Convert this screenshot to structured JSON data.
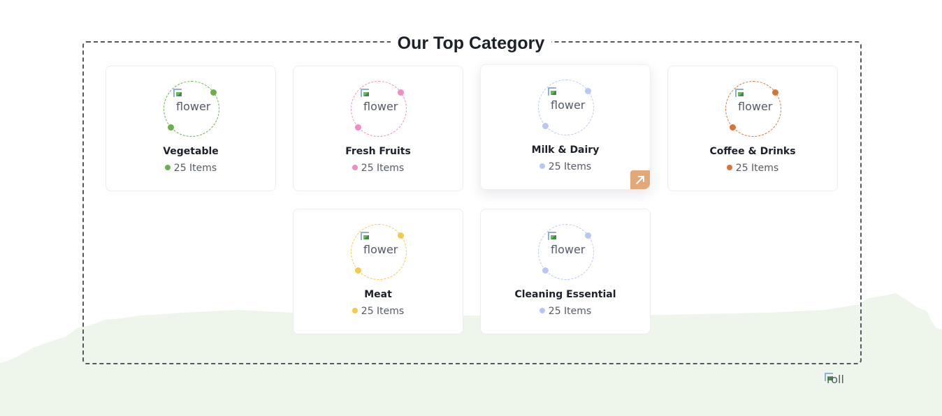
{
  "section": {
    "title": "Our Top Category"
  },
  "categories": [
    {
      "name": "Vegetable",
      "count": "25 Items",
      "image_alt": "flower",
      "color": "#6ab04c"
    },
    {
      "name": "Fresh Fruits",
      "count": "25 Items",
      "image_alt": "flower",
      "color": "#f08bc4"
    },
    {
      "name": "Milk & Dairy",
      "count": "25 Items",
      "image_alt": "flower",
      "color": "#b8c8f5",
      "active": true
    },
    {
      "name": "Coffee & Drinks",
      "count": "25 Items",
      "image_alt": "flower",
      "color": "#d6743a"
    },
    {
      "name": "Meat",
      "count": "25 Items",
      "image_alt": "flower",
      "color": "#f7c948"
    },
    {
      "name": "Cleaning Essential",
      "count": "25 Items",
      "image_alt": "flower",
      "color": "#b8c8f5"
    }
  ],
  "arrow_button": {
    "icon": "arrow-up-right-icon",
    "color": "#e2a878"
  },
  "decor": {
    "image_alt": "roll",
    "hill_color": "#eef5ea"
  }
}
